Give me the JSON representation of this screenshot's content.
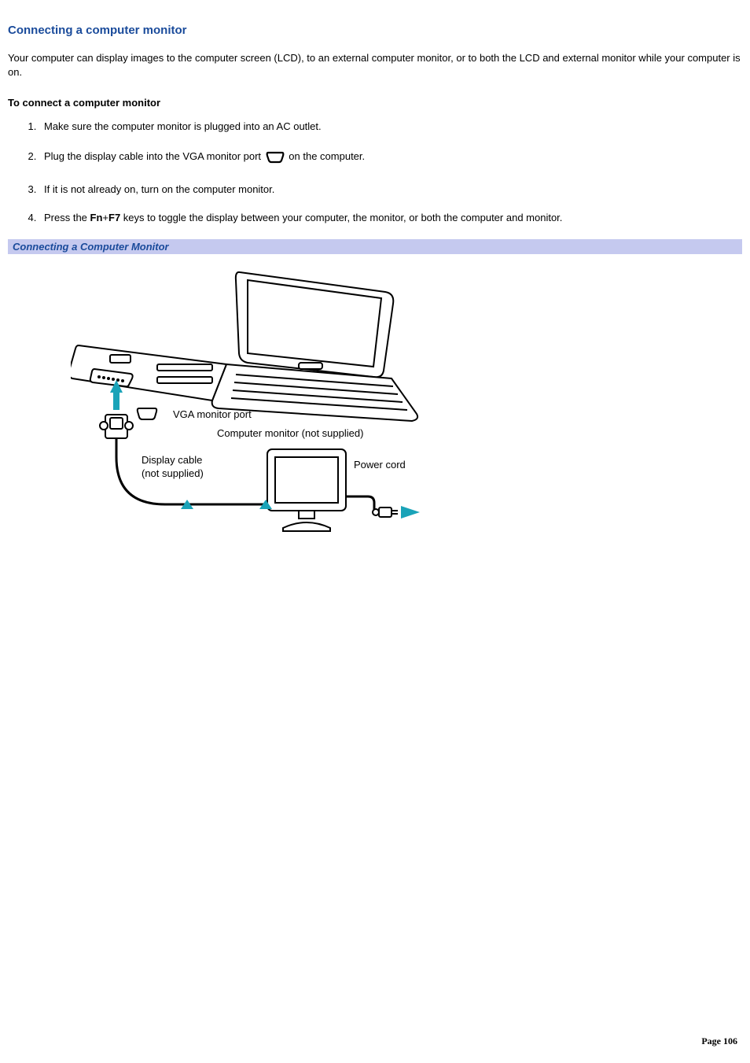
{
  "title": "Connecting a computer monitor",
  "intro": "Your computer can display images to the computer screen (LCD), to an external computer monitor, or to both the LCD and external monitor while your computer is on.",
  "subhead": "To connect a computer monitor",
  "steps": {
    "s1": "Make sure the computer monitor is plugged into an AC outlet.",
    "s2a": "Plug the display cable into the VGA monitor port ",
    "s2b": " on the computer.",
    "s3": "If it is not already on, turn on the computer monitor.",
    "s4a": "Press the ",
    "s4_key1": "Fn",
    "s4_plus": "+",
    "s4_key2": "F7",
    "s4b": " keys to toggle the display between your computer, the monitor, or both the computer and monitor."
  },
  "caption": "Connecting a Computer Monitor",
  "figure_labels": {
    "vga_port": "VGA monitor port",
    "monitor_not_supplied": "Computer monitor (not supplied)",
    "display_cable_l1": "Display cable",
    "display_cable_l2": "(not supplied)",
    "power_cord": "Power cord"
  },
  "footer": "Page 106"
}
